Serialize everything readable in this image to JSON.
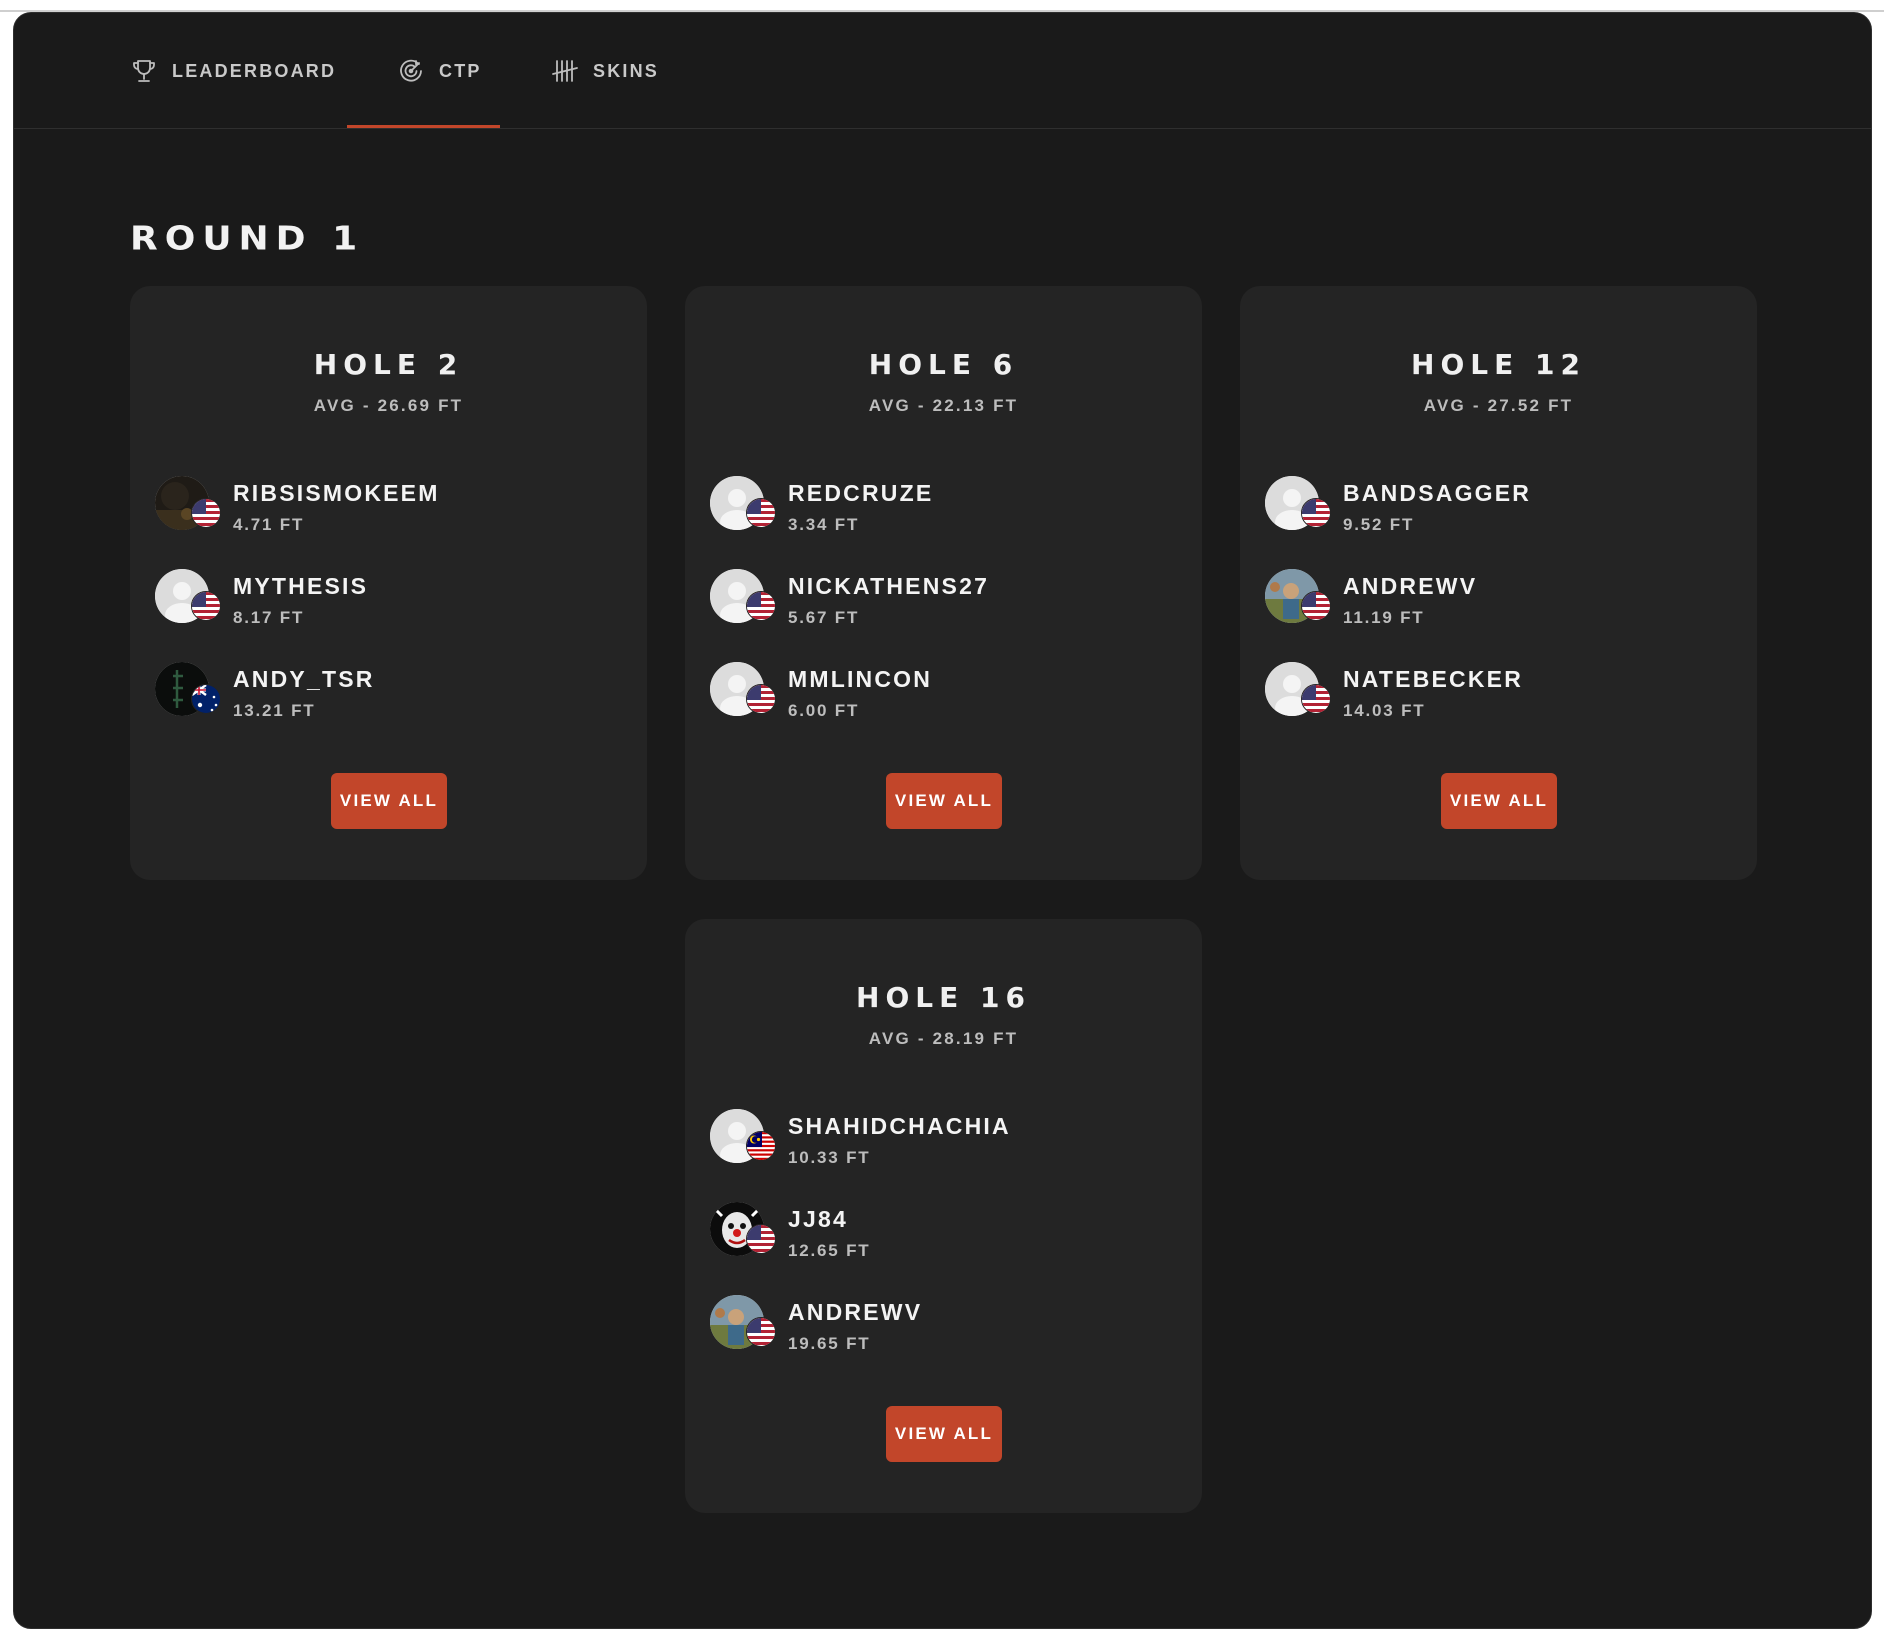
{
  "tabs": [
    {
      "label": "LEADERBOARD",
      "icon": "trophy-icon"
    },
    {
      "label": "CTP",
      "icon": "target-icon"
    },
    {
      "label": "SKINS",
      "icon": "tally-icon"
    }
  ],
  "active_tab": "CTP",
  "round_title": "ROUND 1",
  "accent_color": "#c2462a",
  "view_all_label": "VIEW ALL",
  "holes": [
    {
      "title": "HOLE 2",
      "avg": "AVG - 26.69 FT",
      "players": [
        {
          "name": "RIBSISMOKEEM",
          "distance": "4.71 FT",
          "avatar": "dark-photo",
          "flag": "us-flag"
        },
        {
          "name": "MYTHESIS",
          "distance": "8.17 FT",
          "avatar": "default-person",
          "flag": "us-flag"
        },
        {
          "name": "ANDY_TSR",
          "distance": "13.21 FT",
          "avatar": "tsr-logo",
          "flag": "australia-flag"
        }
      ]
    },
    {
      "title": "HOLE 6",
      "avg": "AVG - 22.13 FT",
      "players": [
        {
          "name": "REDCRUZE",
          "distance": "3.34 FT",
          "avatar": "default-person",
          "flag": "us-flag"
        },
        {
          "name": "NICKATHENS27",
          "distance": "5.67 FT",
          "avatar": "default-person",
          "flag": "us-flag"
        },
        {
          "name": "MMLINCON",
          "distance": "6.00 FT",
          "avatar": "default-person",
          "flag": "us-flag"
        }
      ]
    },
    {
      "title": "HOLE 12",
      "avg": "AVG - 27.52 FT",
      "players": [
        {
          "name": "BANDSAGGER",
          "distance": "9.52 FT",
          "avatar": "default-person",
          "flag": "us-flag"
        },
        {
          "name": "ANDREWV",
          "distance": "11.19 FT",
          "avatar": "outdoor-photo",
          "flag": "us-flag"
        },
        {
          "name": "NATEBECKER",
          "distance": "14.03 FT",
          "avatar": "default-person",
          "flag": "us-flag"
        }
      ]
    },
    {
      "title": "HOLE 16",
      "avg": "AVG - 28.19 FT",
      "players": [
        {
          "name": "SHAHIDCHACHIA",
          "distance": "10.33 FT",
          "avatar": "default-person",
          "flag": "malaysia-flag"
        },
        {
          "name": "JJ84",
          "distance": "12.65 FT",
          "avatar": "clown-photo",
          "flag": "us-flag"
        },
        {
          "name": "ANDREWV",
          "distance": "19.65 FT",
          "avatar": "outdoor-photo",
          "flag": "us-flag"
        }
      ]
    }
  ]
}
